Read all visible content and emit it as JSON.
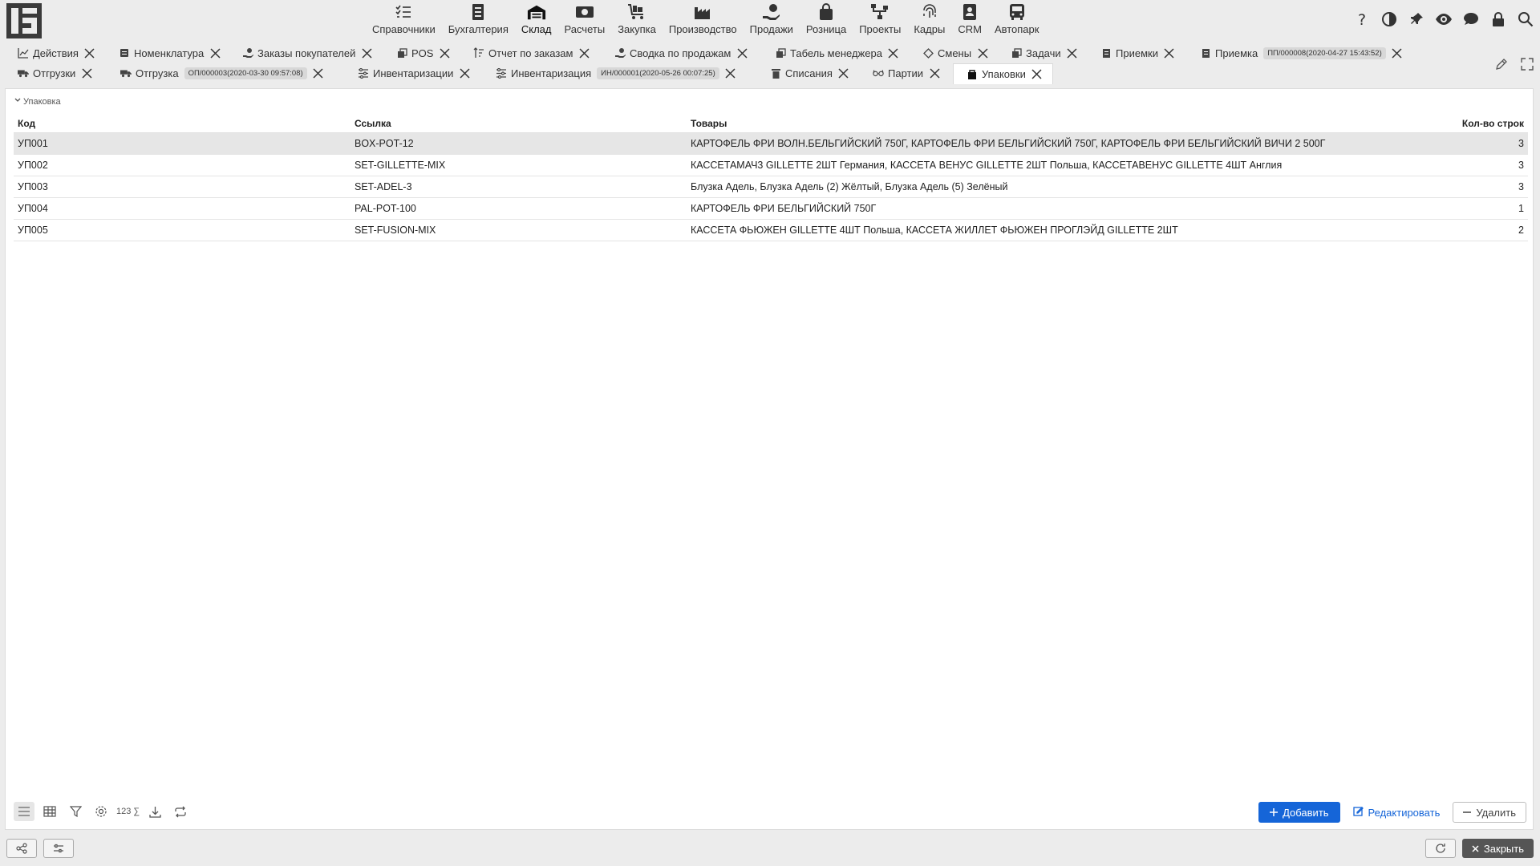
{
  "nav": {
    "items": [
      {
        "label": "Справочники",
        "icon": "checklist-icon"
      },
      {
        "label": "Бухгалтерия",
        "icon": "ledger-icon"
      },
      {
        "label": "Склад",
        "icon": "warehouse-icon"
      },
      {
        "label": "Расчеты",
        "icon": "money-icon"
      },
      {
        "label": "Закупка",
        "icon": "cart-icon"
      },
      {
        "label": "Производство",
        "icon": "factory-icon"
      },
      {
        "label": "Продажи",
        "icon": "hand-coin-icon"
      },
      {
        "label": "Розница",
        "icon": "shopping-bag-icon"
      },
      {
        "label": "Проекты",
        "icon": "project-tree-icon"
      },
      {
        "label": "Кадры",
        "icon": "fingerprint-icon"
      },
      {
        "label": "CRM",
        "icon": "contact-card-icon"
      },
      {
        "label": "Автопарк",
        "icon": "bus-icon"
      }
    ],
    "active": "Склад"
  },
  "tabs": {
    "row1": [
      {
        "label": "Действия",
        "icon": "chart-line-icon"
      },
      {
        "label": "Номенклатура",
        "icon": "catalog-icon"
      },
      {
        "label": "Заказы покупателей",
        "icon": "hand-coin-icon"
      },
      {
        "label": "POS",
        "icon": "copy-icon"
      },
      {
        "label": "Отчет по заказам",
        "icon": "sort-icon"
      },
      {
        "label": "Сводка по продажам",
        "icon": "hand-coin-icon"
      },
      {
        "label": "Табель менеджера",
        "icon": "copy-icon"
      },
      {
        "label": "Смены",
        "icon": "diamond-icon"
      },
      {
        "label": "Задачи",
        "icon": "copy-icon"
      },
      {
        "label": "Приемки",
        "icon": "document-icon"
      },
      {
        "label": "Приемка",
        "icon": "document-icon",
        "badge": "ПП/000008(2020-04-27 15:43:52)"
      }
    ],
    "row2": [
      {
        "label": "Отгрузки",
        "icon": "truck-icon"
      },
      {
        "label": "Отгрузка",
        "icon": "truck-icon",
        "badge": "ОП/000003(2020-03-30 09:57:08)"
      },
      {
        "label": "Инвентаризации",
        "icon": "sliders-icon"
      },
      {
        "label": "Инвентаризация",
        "icon": "sliders-icon",
        "badge": "ИН/000001(2020-05-26 00:07:25)"
      },
      {
        "label": "Списания",
        "icon": "trash-icon"
      },
      {
        "label": "Партии",
        "icon": "glasses-icon"
      },
      {
        "label": "Упаковки",
        "icon": "package-icon"
      }
    ]
  },
  "section": {
    "title": "Упаковка"
  },
  "table": {
    "columns": [
      "Код",
      "Ссылка",
      "Товары",
      "Кол-во строк"
    ],
    "rows": [
      [
        "УП001",
        "BOX-POT-12",
        "КАРТОФЕЛЬ ФРИ ВОЛН.БЕЛЬГИЙСКИЙ 750Г, КАРТОФЕЛЬ ФРИ БЕЛЬГИЙСКИЙ 750Г, КАРТОФЕЛЬ ФРИ БЕЛЬГИЙСКИЙ ВИЧИ 2 500Г",
        "3"
      ],
      [
        "УП002",
        "SET-GILLETTE-MIX",
        "КАССЕТАМАЧ3 GILLETTE 2ШТ Германия, КАССЕТА ВЕНУС GILLETTE 2ШТ Польша, КАССЕТАВЕНУС GILLETTE 4ШТ Англия",
        "3"
      ],
      [
        "УП003",
        "SET-ADEL-3",
        "Блузка Адель, Блузка Адель (2) Жёлтый, Блузка Адель (5) Зелёный",
        "3"
      ],
      [
        "УП004",
        "PAL-POT-100",
        "КАРТОФЕЛЬ ФРИ БЕЛЬГИЙСКИЙ 750Г",
        "1"
      ],
      [
        "УП005",
        "SET-FUSION-MIX",
        "КАССЕТА ФЬЮЖЕН GILLETTE 4ШТ Польша, КАССЕТА ЖИЛЛЕТ ФЬЮЖЕН ПРОГЛЭЙД GILLETTE 2ШТ",
        "2"
      ]
    ]
  },
  "toolbar": {
    "sum_label": "123 ∑"
  },
  "actions": {
    "add": "Добавить",
    "edit": "Редактировать",
    "delete": "Удалить"
  },
  "footer": {
    "close": "Закрыть"
  },
  "colors": {
    "accent": "#1565d8",
    "selected_row": "#e6e6e6"
  }
}
